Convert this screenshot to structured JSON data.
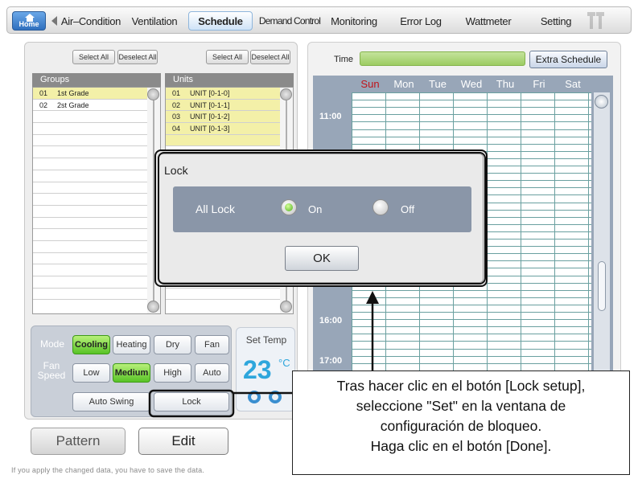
{
  "topnav": {
    "home_label": "Home",
    "tabs": [
      {
        "label": "Air–Condition"
      },
      {
        "label": "Ventilation"
      },
      {
        "label": "Schedule"
      },
      {
        "label": "Demand Control"
      },
      {
        "label": "Monitoring"
      },
      {
        "label": "Error Log"
      },
      {
        "label": "Wattmeter"
      },
      {
        "label": "Setting"
      }
    ]
  },
  "groups": {
    "select_all": "Select All",
    "deselect_all": "Deselect All",
    "header": "Groups",
    "rows": [
      {
        "num": "01",
        "name": "1st Grade"
      },
      {
        "num": "02",
        "name": "2st Grade"
      }
    ]
  },
  "units": {
    "select_all": "Select All",
    "deselect_all": "Deselect All",
    "header": "Units",
    "rows": [
      {
        "num": "01",
        "name": "UNIT [0-1-0]"
      },
      {
        "num": "02",
        "name": "UNIT [0-1-1]"
      },
      {
        "num": "03",
        "name": "UNIT [0-1-2]"
      },
      {
        "num": "04",
        "name": "UNIT [0-1-3]"
      }
    ]
  },
  "controls": {
    "mode_label": "Mode",
    "modes": [
      "Cooling",
      "Heating",
      "Dry",
      "Fan"
    ],
    "fan_label_1": "Fan",
    "fan_label_2": "Speed",
    "fan_speeds": [
      "Low",
      "Medium",
      "High",
      "Auto"
    ],
    "auto_swing": "Auto Swing",
    "lock": "Lock",
    "set_temp_label": "Set Temp",
    "set_temp_value": "23",
    "set_temp_unit": "°C"
  },
  "buttons": {
    "pattern": "Pattern",
    "edit": "Edit"
  },
  "footer_note": "If you apply the changed data,  you have to save the data.",
  "schedule": {
    "time_label": "Time",
    "extra_schedule": "Extra Schedule",
    "days": [
      "Sun",
      "Mon",
      "Tue",
      "Wed",
      "Thu",
      "Fri",
      "Sat"
    ],
    "hours": [
      {
        "label": "11:00"
      },
      {
        "label": "16:00"
      },
      {
        "label": "17:00"
      }
    ]
  },
  "dialog": {
    "title": "Lock",
    "row_label": "All Lock",
    "on_label": "On",
    "off_label": "Off",
    "ok_label": "OK"
  },
  "annotation": {
    "lines": [
      "Tras hacer clic en el botón [Lock setup],",
      "seleccione \"Set\" en la ventana de",
      "configuración de bloqueo.",
      "Haga clic en el botón [Done]."
    ]
  },
  "colors": {
    "active_green": "#58c326",
    "selected_row": "#f3f0a8",
    "schedule_frame": "#98a6b8",
    "temp_blue": "#2ea6dc",
    "sunday_red": "#c0141a"
  }
}
